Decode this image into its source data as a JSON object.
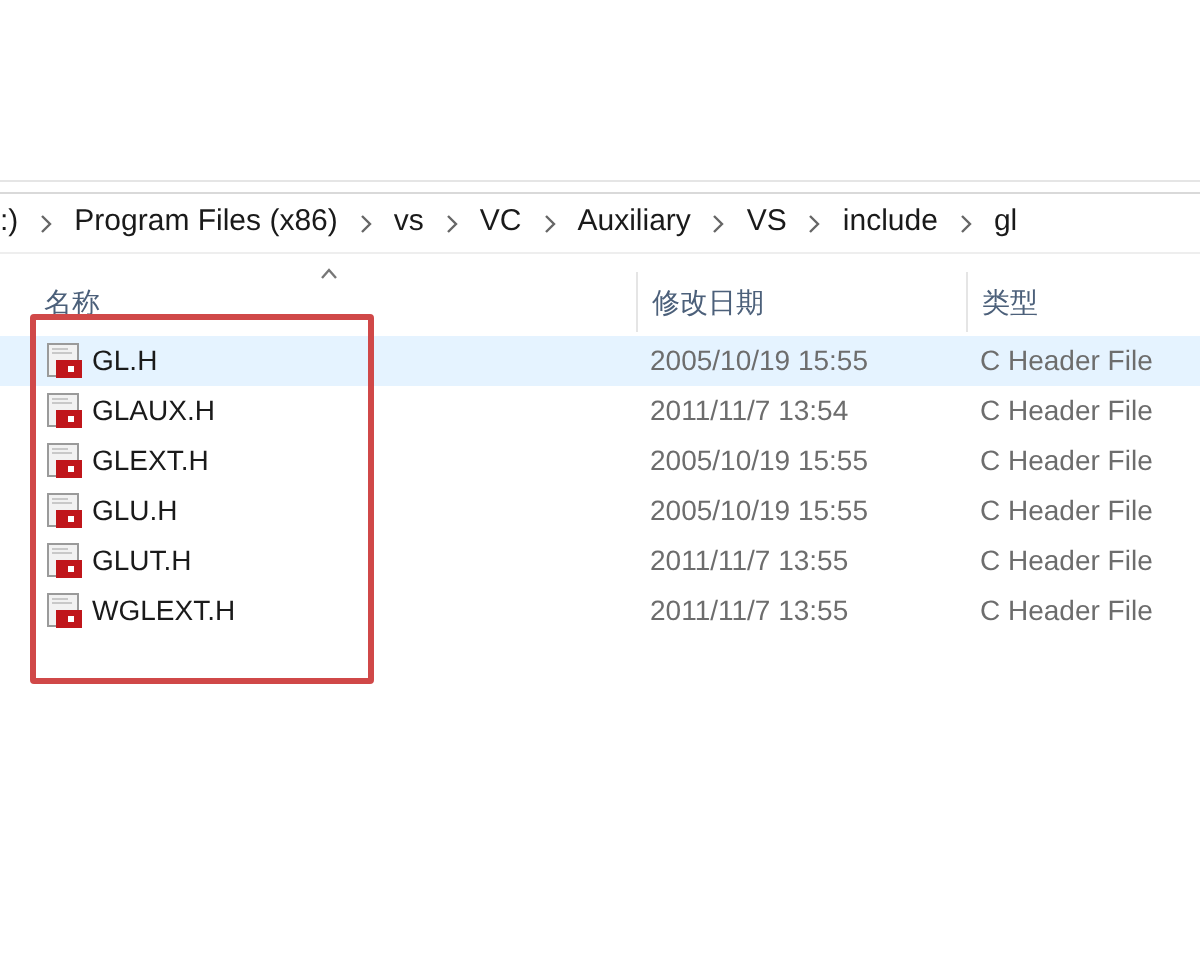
{
  "breadcrumb": [
    ":)",
    "Program Files (x86)",
    "vs",
    "VC",
    "Auxiliary",
    "VS",
    "include",
    "gl"
  ],
  "columns": [
    {
      "label": "名称",
      "sorted": true
    },
    {
      "label": "修改日期",
      "sorted": false
    },
    {
      "label": "类型",
      "sorted": false
    }
  ],
  "rows": [
    {
      "name": "GL.H",
      "modified": "2005/10/19 15:55",
      "type": "C Header File",
      "selected": true
    },
    {
      "name": "GLAUX.H",
      "modified": "2011/11/7 13:54",
      "type": "C Header File",
      "selected": false
    },
    {
      "name": "GLEXT.H",
      "modified": "2005/10/19 15:55",
      "type": "C Header File",
      "selected": false
    },
    {
      "name": "GLU.H",
      "modified": "2005/10/19 15:55",
      "type": "C Header File",
      "selected": false
    },
    {
      "name": "GLUT.H",
      "modified": "2011/11/7 13:55",
      "type": "C Header File",
      "selected": false
    },
    {
      "name": "WGLEXT.H",
      "modified": "2011/11/7 13:55",
      "type": "C Header File",
      "selected": false
    }
  ],
  "annotation": {
    "kind": "highlight-box",
    "color": "#d04848"
  }
}
